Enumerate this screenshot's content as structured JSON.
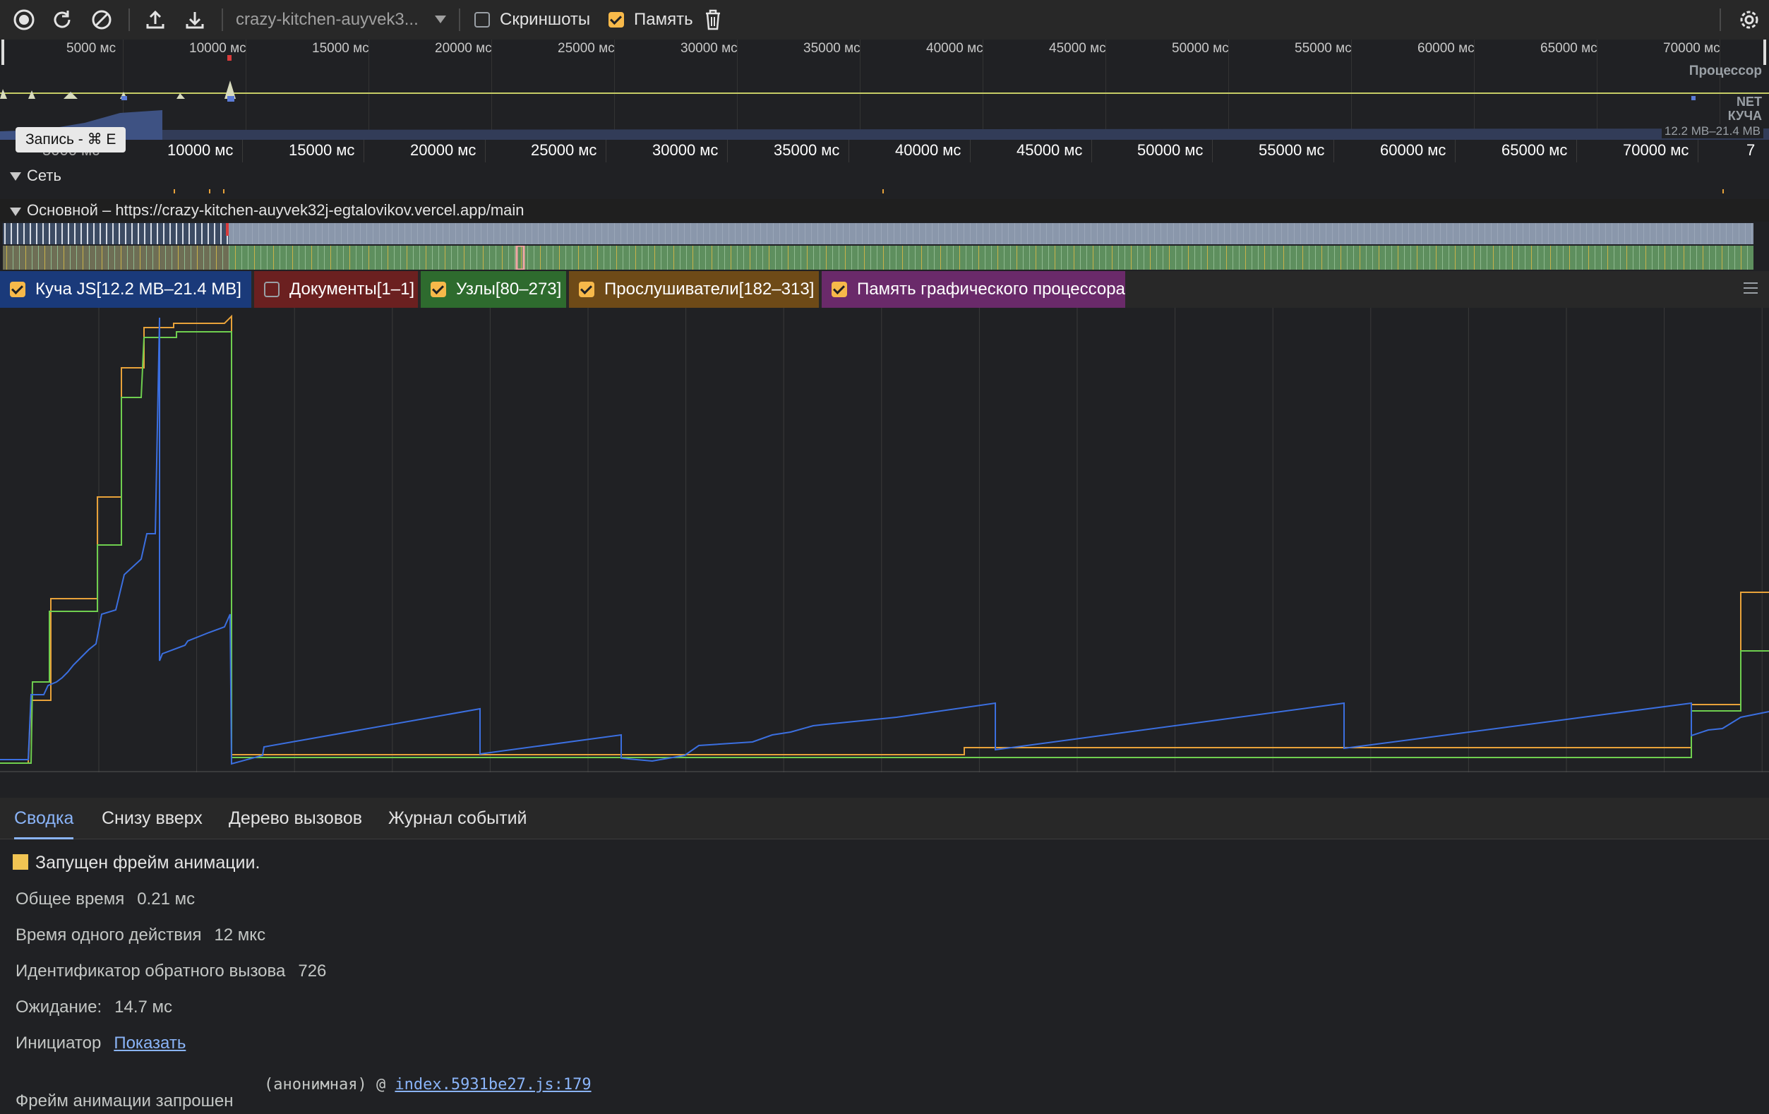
{
  "toolbar": {
    "profile_select": "crazy-kitchen-auyvek3...",
    "screenshots_label": "Скриншоты",
    "screenshots_checked": false,
    "memory_label": "Память",
    "memory_checked": true
  },
  "overview": {
    "ticks": [
      "5000 мс",
      "10000 мс",
      "15000 мс",
      "20000 мс",
      "25000 мс",
      "30000 мс",
      "35000 мс",
      "40000 мс",
      "45000 мс",
      "50000 мс",
      "55000 мс",
      "60000 мс",
      "65000 мс",
      "70000 мс"
    ],
    "cpu_label": "Процессор",
    "net_label": "NET",
    "heap_label": "КУЧА",
    "heap_range": "12.2 MB–21.4 MB"
  },
  "tooltip": "Запись - ⌘ E",
  "ruler": {
    "first_partial": "5000 мс",
    "ticks": [
      "10000 мс",
      "15000 мс",
      "20000 мс",
      "25000 мс",
      "30000 мс",
      "35000 мс",
      "40000 мс",
      "45000 мс",
      "50000 мс",
      "55000 мс",
      "60000 мс",
      "65000 мс",
      "70000 мс"
    ],
    "last_partial": "7"
  },
  "tracks": {
    "network": "Сеть",
    "main": "Основной – https://crazy-kitchen-auyvek32j-egtalovikov.vercel.app/main"
  },
  "counters": [
    {
      "label": "Куча JS[12.2 MB–21.4 MB]",
      "checked": true,
      "bg": "#1a3a7a"
    },
    {
      "label": "Документы[1–1]",
      "checked": false,
      "bg": "#6b2020"
    },
    {
      "label": "Узлы[80–273]",
      "checked": true,
      "bg": "#2e6b2e"
    },
    {
      "label": "Прослушиватели[182–313]",
      "checked": true,
      "bg": "#6e4a17"
    },
    {
      "label": "Память графического процессора",
      "checked": true,
      "bg": "#6a2a6a"
    }
  ],
  "colors": {
    "heap": "#3b6fe0",
    "nodes": "#6fcf4f",
    "listeners": "#e8a23a",
    "accent": "#8ab4f8",
    "checkbox": "#f7b94a"
  },
  "tabs": [
    "Сводка",
    "Снизу вверх",
    "Дерево вызовов",
    "Журнал событий"
  ],
  "summary": {
    "title": "Запущен фрейм анимации.",
    "title_color": "#f1c453",
    "total_time_label": "Общее время",
    "total_time": "0.21 мс",
    "self_time_label": "Время одного действия",
    "self_time": "12 мкс",
    "callback_id_label": "Идентификатор обратного вызова",
    "callback_id": "726",
    "pending_label": "Ожидание:",
    "pending": "14.7 мс",
    "initiator_label": "Инициатор",
    "initiator_link": "Показать",
    "requested_label": "Фрейм анимации запрошен",
    "stack_fn": "(анонимная) @",
    "stack_link": "index.5931be27.js:179"
  }
}
